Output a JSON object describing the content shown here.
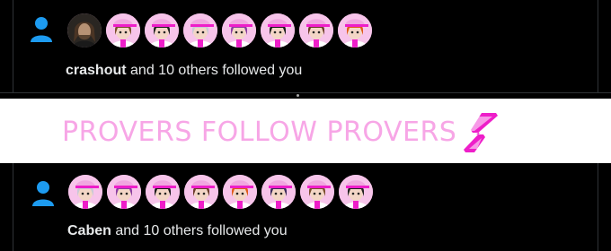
{
  "colors": {
    "background": "#000000",
    "text": "#e7e9ea",
    "accent_blue": "#1d9bf0",
    "banner_bg": "#ffffff",
    "banner_text": "#f7a6e6",
    "logo_magenta": "#ee1ec9"
  },
  "top_notification": {
    "icon": "person-icon",
    "avatars": [
      {
        "name": "photo-avatar",
        "kind": "photo"
      },
      {
        "name": "prover-avatar",
        "kind": "prover"
      },
      {
        "name": "prover-avatar",
        "kind": "prover"
      },
      {
        "name": "prover-avatar",
        "kind": "prover"
      },
      {
        "name": "prover-avatar",
        "kind": "prover"
      },
      {
        "name": "prover-avatar",
        "kind": "prover"
      },
      {
        "name": "prover-avatar",
        "kind": "prover"
      },
      {
        "name": "prover-avatar",
        "kind": "prover"
      }
    ],
    "username": "crashout",
    "rest": " and 10 others followed you"
  },
  "banner": {
    "text": "PROVERS FOLLOW PROVERS",
    "logo_icon": "succinct-logo-icon"
  },
  "bottom_notification": {
    "icon": "person-icon",
    "avatars": [
      {
        "name": "prover-avatar",
        "kind": "prover"
      },
      {
        "name": "prover-avatar",
        "kind": "prover"
      },
      {
        "name": "prover-avatar",
        "kind": "prover"
      },
      {
        "name": "prover-avatar",
        "kind": "prover"
      },
      {
        "name": "prover-avatar",
        "kind": "prover"
      },
      {
        "name": "prover-avatar",
        "kind": "prover"
      },
      {
        "name": "prover-avatar",
        "kind": "prover"
      },
      {
        "name": "prover-avatar",
        "kind": "prover"
      }
    ],
    "username": "Caben",
    "rest": " and 10 others followed you"
  }
}
